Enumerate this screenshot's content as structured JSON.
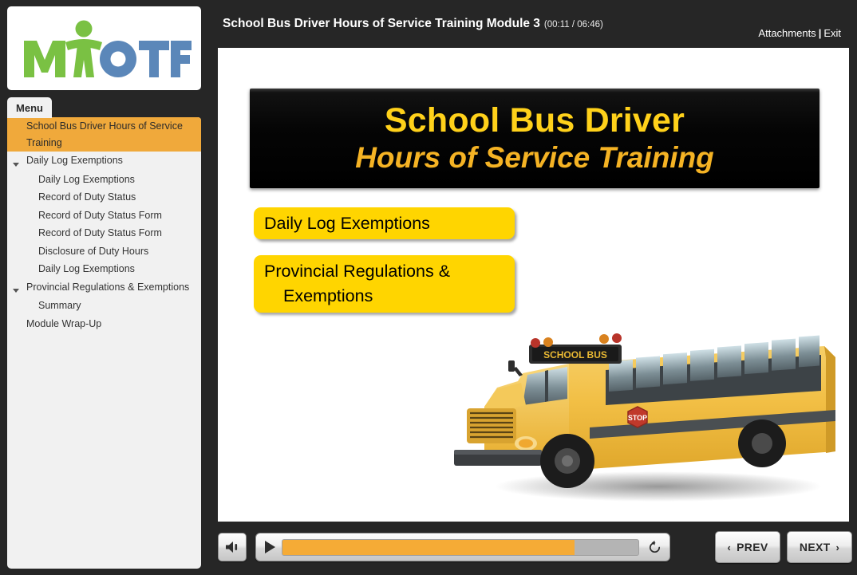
{
  "header": {
    "title": "School Bus Driver Hours of Service Training Module 3",
    "timecode": "(00:11 / 06:46)",
    "attachments_label": "Attachments",
    "separator": "|",
    "exit_label": "Exit"
  },
  "sidebar": {
    "logo_alt": "MYOTF",
    "logo_text_green": "MY",
    "logo_text_blue": "OTF",
    "menu_tab_label": "Menu",
    "items": [
      {
        "label": "School Bus Driver Hours of Service Training",
        "level": 0,
        "selected": true,
        "expandable": false
      },
      {
        "label": "Daily Log Exemptions",
        "level": 0,
        "selected": false,
        "expandable": true
      },
      {
        "label": "Daily Log Exemptions",
        "level": 1,
        "selected": false,
        "expandable": false
      },
      {
        "label": "Record of Duty Status",
        "level": 1,
        "selected": false,
        "expandable": false
      },
      {
        "label": "Record of Duty Status Form",
        "level": 1,
        "selected": false,
        "expandable": false
      },
      {
        "label": "Record of Duty Status Form",
        "level": 1,
        "selected": false,
        "expandable": false
      },
      {
        "label": "Disclosure of Duty Hours",
        "level": 1,
        "selected": false,
        "expandable": false
      },
      {
        "label": "Daily Log Exemptions",
        "level": 1,
        "selected": false,
        "expandable": false
      },
      {
        "label": "Provincial Regulations & Exemptions",
        "level": 0,
        "selected": false,
        "expandable": true
      },
      {
        "label": "Summary",
        "level": 1,
        "selected": false,
        "expandable": false
      },
      {
        "label": "Module Wrap-Up",
        "level": 0,
        "selected": false,
        "expandable": false
      }
    ]
  },
  "slide": {
    "banner_line1": "School Bus Driver",
    "banner_line2": "Hours of Service Training",
    "callout_1": "Daily Log Exemptions",
    "callout_2_line1": "Provincial Regulations &",
    "callout_2_line2": "Exemptions",
    "bus_sign_text": "SCHOOL BUS",
    "bus_stop_sign_text": "STOP"
  },
  "controls": {
    "volume_icon": "volume-icon",
    "play_icon": "play-icon",
    "replay_icon": "replay-icon",
    "progress_percent": 82,
    "prev_label": "PREV",
    "next_label": "NEXT",
    "prev_chevron": "‹",
    "next_chevron": "›"
  },
  "colors": {
    "app_background": "#262626",
    "panel": "#f1f1f1",
    "selected_item": "#f0a93b",
    "progress_fill": "#f5ab36",
    "callout_yellow": "#ffd500",
    "banner_gold": "#ffd11a",
    "banner_gold_italic": "#f5b324",
    "logo_green": "#7ac143",
    "logo_blue": "#5b87b9"
  }
}
